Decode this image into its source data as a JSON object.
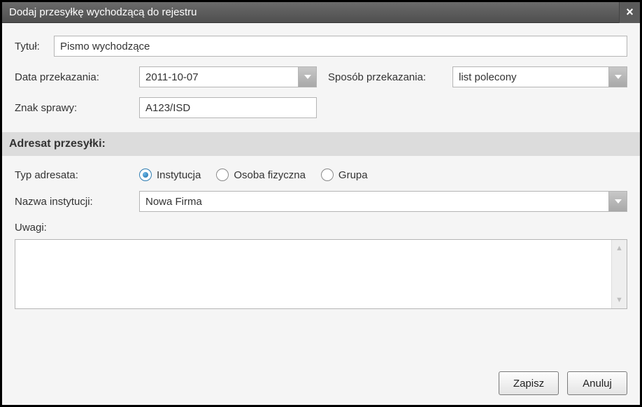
{
  "window": {
    "title": "Dodaj przesyłkę wychodzącą do rejestru"
  },
  "labels": {
    "tytul": "Tytuł:",
    "data_przekazania": "Data przekazania:",
    "sposob_przekazania": "Sposób przekazania:",
    "znak_sprawy": "Znak sprawy:",
    "section_adresat": "Adresat przesyłki:",
    "typ_adresata": "Typ adresata:",
    "nazwa_instytucji": "Nazwa instytucji:",
    "uwagi": "Uwagi:"
  },
  "fields": {
    "tytul": "Pismo wychodzące",
    "data_przekazania": "2011-10-07",
    "sposob_przekazania": "list polecony",
    "znak_sprawy": "A123/ISD",
    "nazwa_instytucji": "Nowa Firma",
    "uwagi": ""
  },
  "radios": {
    "instytucja": "Instytucja",
    "osoba": "Osoba fizyczna",
    "grupa": "Grupa",
    "selected": "instytucja"
  },
  "buttons": {
    "zapisz": "Zapisz",
    "anuluj": "Anuluj"
  }
}
